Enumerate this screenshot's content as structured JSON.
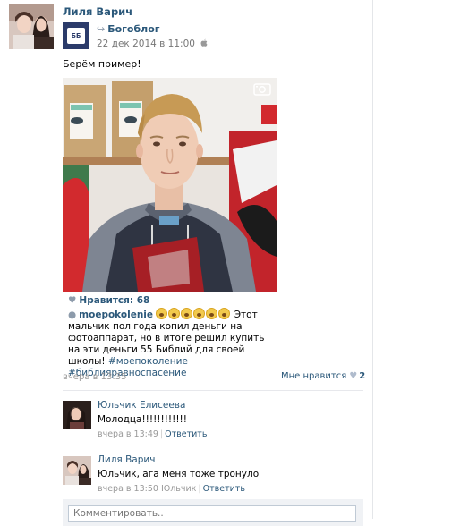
{
  "post": {
    "author": "Лиля Варич",
    "group": "Богоблог",
    "group_avatar_text": "ББ",
    "date": "22 дек 2014 в 11:00",
    "text": "Берём пример!",
    "likes_label": "Нравится: 68",
    "caption_user": "moepokolenie",
    "caption_text": "Этот мальчик пол года копил деньги на фотоаппарат, но в итоге решил купить на эти деньги 55 Библий для своей школы!",
    "caption_tags": "#моепоколение #библияравноспасение",
    "time": "вчера в 13:35",
    "like_button": "Мне нравится",
    "like_count": "2"
  },
  "comments": [
    {
      "name": "Юльчик Елисеева",
      "text": "Молодца!!!!!!!!!!!!",
      "time": "вчера в 13:49",
      "reply": "Ответить",
      "reply_to": ""
    },
    {
      "name": "Лиля Варич",
      "text": "Юльчик, ага меня тоже тронуло",
      "time": "вчера в 13:50",
      "reply_to": "Юльчик",
      "reply": "Ответить"
    }
  ],
  "comment_placeholder": "Комментировать..",
  "colors": {
    "link": "#2b587a",
    "muted": "#999999",
    "divider": "#e7e8ec"
  },
  "icons": [
    "repost-icon",
    "apple-icon",
    "video-camera-icon",
    "heart-icon",
    "comment-bubble-icon",
    "emoji-icon"
  ]
}
